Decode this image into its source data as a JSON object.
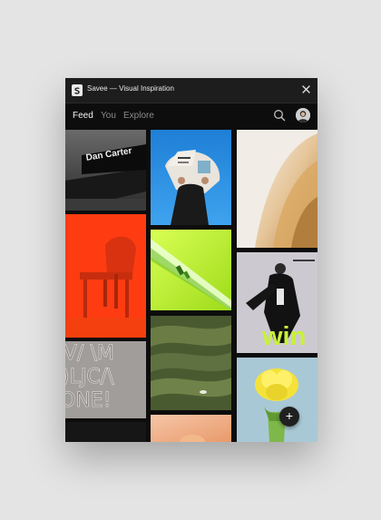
{
  "window": {
    "title": "Savee — Visual Inspiration",
    "app_icon": "savee-logo-icon",
    "close_icon": "close-icon"
  },
  "nav": {
    "tabs": [
      {
        "label": "Feed",
        "active": true
      },
      {
        "label": "You",
        "active": false
      },
      {
        "label": "Explore",
        "active": false
      }
    ],
    "search_icon": "search-icon",
    "avatar_icon": "user-avatar"
  },
  "feed": {
    "tiles": [
      {
        "name": "dan-carter-poster",
        "caption": "Dan Carter"
      },
      {
        "name": "newspaper-reader-photo"
      },
      {
        "name": "gold-abstract-render"
      },
      {
        "name": "red-chair-photo"
      },
      {
        "name": "green-glass-render"
      },
      {
        "name": "fashion-magazine-cover",
        "caption": "win"
      },
      {
        "name": "typography-relief"
      },
      {
        "name": "green-fabric-photo"
      },
      {
        "name": "yellow-flower-photo"
      },
      {
        "name": "peach-gradient-tile"
      }
    ]
  },
  "fab": {
    "label": "+",
    "icon": "plus-icon"
  },
  "colors": {
    "background": "#e4e4e4",
    "window": "#0d0d0d",
    "titlebar": "#1d1d1d",
    "active_tab": "#f2f2f2",
    "inactive_tab": "#8a8a8a",
    "accent_lime": "#c8f23a",
    "accent_red": "#ff3b12"
  }
}
